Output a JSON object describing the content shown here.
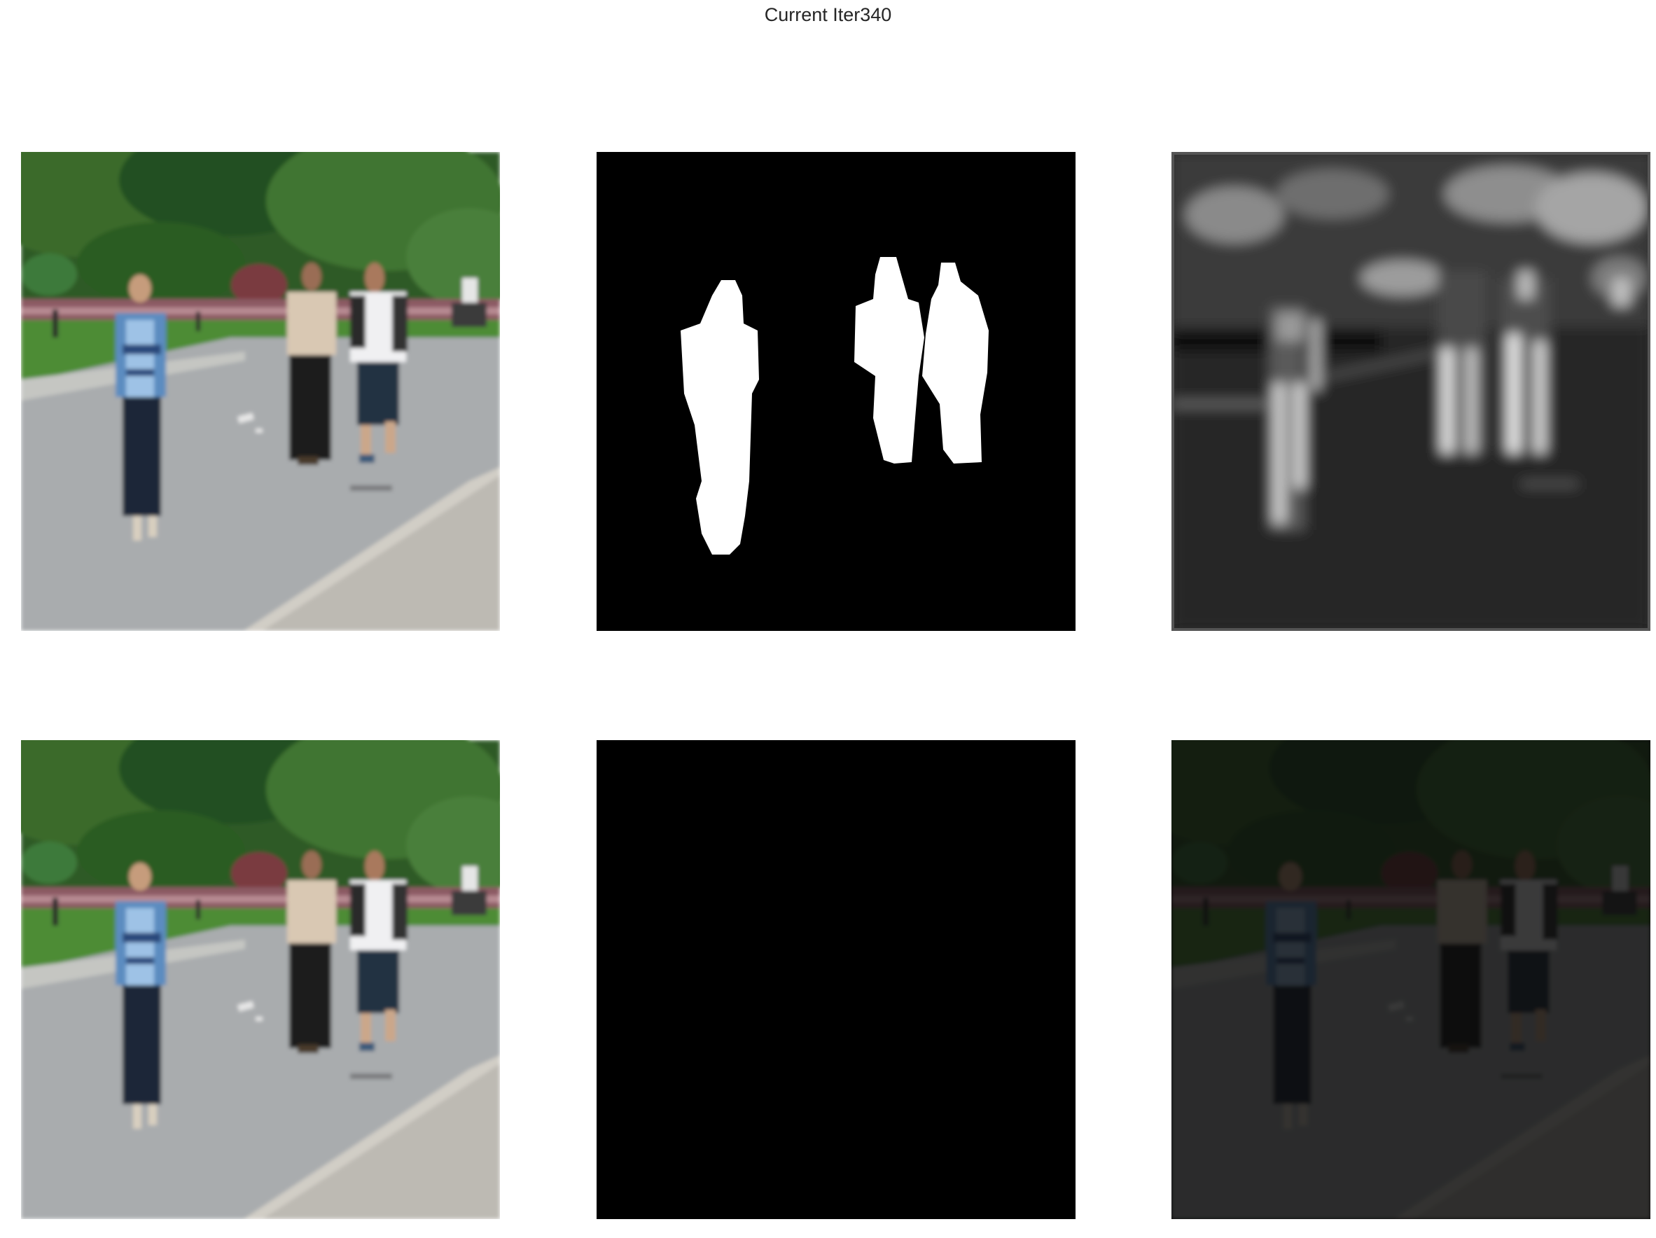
{
  "figure": {
    "title": "Current Iter340"
  },
  "panels": [
    {
      "row": 1,
      "col": 1,
      "content": "input-photo"
    },
    {
      "row": 1,
      "col": 2,
      "content": "binary-mask"
    },
    {
      "row": 1,
      "col": 3,
      "content": "predicted-saliency-map"
    },
    {
      "row": 2,
      "col": 1,
      "content": "input-photo"
    },
    {
      "row": 2,
      "col": 2,
      "content": "masked-photo"
    },
    {
      "row": 2,
      "col": 3,
      "content": "prediction-overlay"
    }
  ]
}
